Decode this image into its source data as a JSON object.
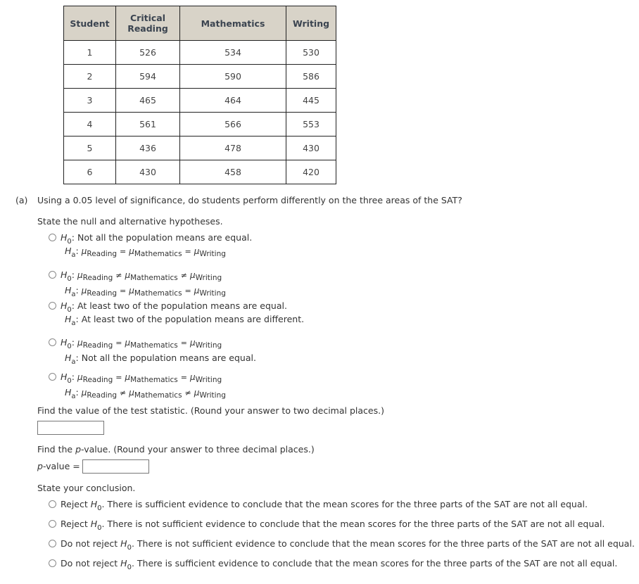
{
  "table": {
    "headers": [
      "Student",
      "Critical Reading",
      "Mathematics",
      "Writing"
    ],
    "header_lines": [
      [
        "Student"
      ],
      [
        "Critical",
        "Reading"
      ],
      [
        "Mathematics"
      ],
      [
        "Writing"
      ]
    ],
    "rows": [
      [
        "1",
        "526",
        "534",
        "530"
      ],
      [
        "2",
        "594",
        "590",
        "586"
      ],
      [
        "3",
        "465",
        "464",
        "445"
      ],
      [
        "4",
        "561",
        "566",
        "553"
      ],
      [
        "5",
        "436",
        "478",
        "430"
      ],
      [
        "6",
        "430",
        "458",
        "420"
      ]
    ],
    "header_bg": "#d8d3c8"
  },
  "part_a": {
    "label": "(a)",
    "question": "Using a 0.05 level of significance, do students perform differently on the three areas of the SAT?",
    "hypotheses_prompt": "State the null and alternative hypotheses.",
    "symbols": {
      "H": "H",
      "null_sub": "0",
      "alt_sub": "a",
      "colon": ":",
      "mu": "μ",
      "reading": "Reading",
      "mathematics": "Mathematics",
      "writing": "Writing",
      "eq": "=",
      "neq": "≠"
    },
    "hypothesis_options": [
      {
        "h0_text": "Not all the population means are equal.",
        "ha_ops": [
          "=",
          "="
        ]
      },
      {
        "h0_ops": [
          "≠",
          "≠"
        ],
        "ha_ops": [
          "=",
          "="
        ]
      },
      {
        "h0_text": "At least two of the population means are equal.",
        "ha_text": "At least two of the population means are different."
      },
      {
        "h0_ops": [
          "=",
          "="
        ],
        "ha_text": "Not all the population means are equal."
      },
      {
        "h0_ops": [
          "=",
          "="
        ],
        "ha_ops": [
          "≠",
          "≠"
        ]
      }
    ],
    "test_statistic_prompt": "Find the value of the test statistic. (Round your answer to two decimal places.)",
    "test_statistic_value": "",
    "pvalue_prompt_pre": "Find the ",
    "pvalue_prompt_p": "p",
    "pvalue_prompt_post": "-value. (Round your answer to three decimal places.)",
    "pvalue_label_p": "p",
    "pvalue_label_post": "-value =",
    "pvalue_value": "",
    "conclusion_prompt": "State your conclusion.",
    "conclusion_options": [
      {
        "decision": "Reject",
        "rest": ". There is sufficient evidence to conclude that the mean scores for the three parts of the SAT are not all equal."
      },
      {
        "decision": "Reject",
        "rest": ". There is not sufficient evidence to conclude that the mean scores for the three parts of the SAT are not all equal."
      },
      {
        "decision": "Do not reject",
        "rest": ". There is not sufficient evidence to conclude that the mean scores for the three parts of the SAT are not all equal."
      },
      {
        "decision": "Do not reject",
        "rest": ". There is sufficient evidence to conclude that the mean scores for the three parts of the SAT are not all equal."
      }
    ]
  }
}
